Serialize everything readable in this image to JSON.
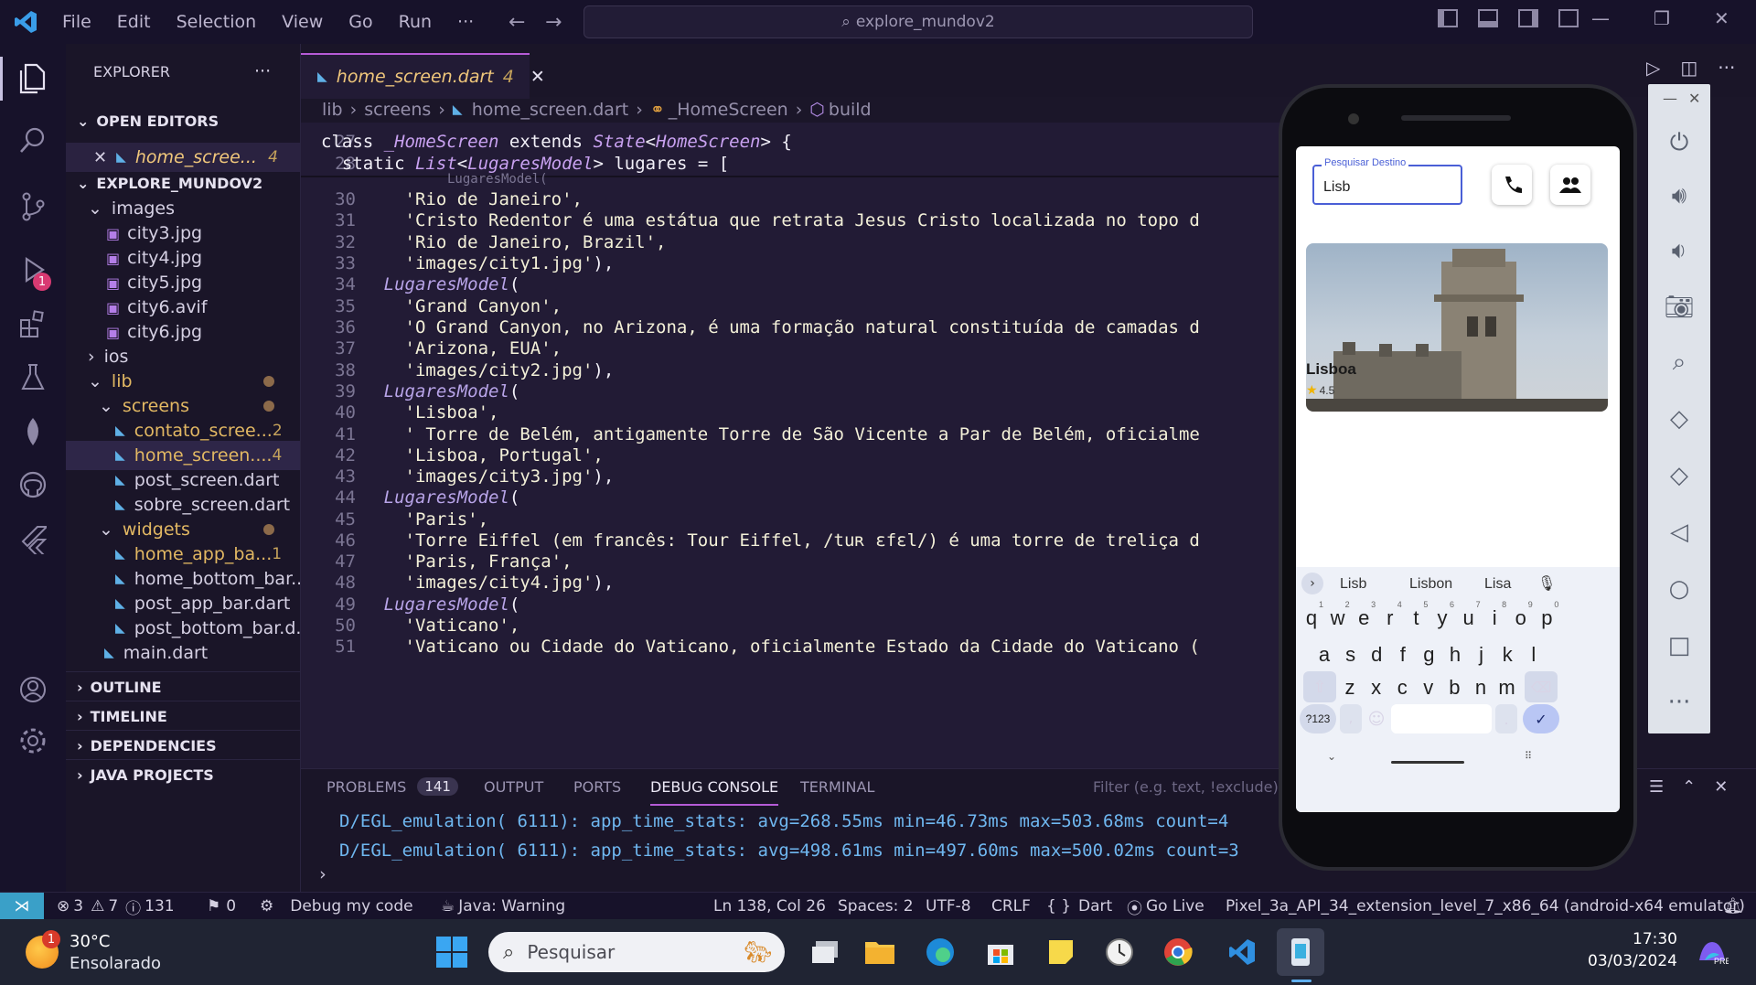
{
  "menu": [
    "File",
    "Edit",
    "Selection",
    "View",
    "Go",
    "Run",
    "···"
  ],
  "search": "explore_mundov2",
  "explorer": {
    "title": "EXPLORER",
    "open_editors": "OPEN EDITORS",
    "open_file": "home_scree...",
    "open_badge": "4",
    "project": "EXPLORE_MUNDOV2",
    "tree": [
      {
        "label": "images",
        "indent": 1,
        "type": "folder-open"
      },
      {
        "label": "city3.jpg",
        "indent": 2,
        "type": "img"
      },
      {
        "label": "city4.jpg",
        "indent": 2,
        "type": "img"
      },
      {
        "label": "city5.jpg",
        "indent": 2,
        "type": "img"
      },
      {
        "label": "city6.avif",
        "indent": 2,
        "type": "img"
      },
      {
        "label": "city6.jpg",
        "indent": 2,
        "type": "img"
      },
      {
        "label": "ios",
        "indent": 1,
        "type": "folder"
      },
      {
        "label": "lib",
        "indent": 1,
        "type": "folder-open-dot"
      },
      {
        "label": "screens",
        "indent": 2,
        "type": "folder-open-dot"
      },
      {
        "label": "contato_scree...",
        "indent": 3,
        "type": "dart-warn",
        "badge": "2"
      },
      {
        "label": "home_screen....",
        "indent": 3,
        "type": "dart-warn",
        "badge": "4",
        "active": true
      },
      {
        "label": "post_screen.dart",
        "indent": 3,
        "type": "dart"
      },
      {
        "label": "sobre_screen.dart",
        "indent": 3,
        "type": "dart"
      },
      {
        "label": "widgets",
        "indent": 2,
        "type": "folder-open-dot"
      },
      {
        "label": "home_app_ba...",
        "indent": 3,
        "type": "dart-warn",
        "badge": "1"
      },
      {
        "label": "home_bottom_bar....",
        "indent": 3,
        "type": "dart"
      },
      {
        "label": "post_app_bar.dart",
        "indent": 3,
        "type": "dart"
      },
      {
        "label": "post_bottom_bar.d...",
        "indent": 3,
        "type": "dart"
      },
      {
        "label": "main.dart",
        "indent": 2,
        "type": "dart"
      }
    ],
    "bottom_sections": [
      "OUTLINE",
      "TIMELINE",
      "DEPENDENCIES",
      "JAVA PROJECTS"
    ]
  },
  "tab": {
    "label": "home_screen.dart",
    "badge": "4"
  },
  "breadcrumb": [
    "lib",
    "screens",
    "home_screen.dart",
    "_HomeScreen",
    "build"
  ],
  "code": [
    {
      "n": "27",
      "parts": [
        [
          "kw",
          "class "
        ],
        [
          "cls",
          "_HomeScreen "
        ],
        [
          "kw",
          "extends "
        ],
        [
          "cls",
          "State"
        ],
        [
          "kw",
          "<"
        ],
        [
          "cls",
          "HomeScreen"
        ],
        [
          "kw",
          "> {"
        ]
      ]
    },
    {
      "n": "28",
      "parts": [
        [
          "kw",
          "  static "
        ],
        [
          "cls",
          "List"
        ],
        [
          "kw",
          "<"
        ],
        [
          "cls",
          "LugaresModel"
        ],
        [
          "kw",
          "> lugares = ["
        ]
      ]
    },
    {
      "n": "30",
      "parts": [
        [
          "str",
          "        'Rio de Janeiro',"
        ]
      ]
    },
    {
      "n": "31",
      "parts": [
        [
          "str",
          "        'Cristo Redentor é uma estátua que retrata Jesus Cristo localizada no topo d"
        ]
      ]
    },
    {
      "n": "32",
      "parts": [
        [
          "str",
          "        'Rio de Janeiro, Brazil',"
        ]
      ]
    },
    {
      "n": "33",
      "parts": [
        [
          "str",
          "        'images/city1.jpg'"
        ],
        [
          "kw",
          "),"
        ]
      ]
    },
    {
      "n": "34",
      "parts": [
        [
          "lm",
          "      LugaresModel"
        ],
        [
          "kw",
          "("
        ]
      ]
    },
    {
      "n": "35",
      "parts": [
        [
          "str",
          "        'Grand Canyon',"
        ]
      ]
    },
    {
      "n": "36",
      "parts": [
        [
          "str",
          "        'O Grand Canyon, no Arizona, é uma formação natural constituída de camadas d"
        ]
      ]
    },
    {
      "n": "37",
      "parts": [
        [
          "str",
          "        'Arizona, EUA',"
        ]
      ]
    },
    {
      "n": "38",
      "parts": [
        [
          "str",
          "        'images/city2.jpg'"
        ],
        [
          "kw",
          "),"
        ]
      ]
    },
    {
      "n": "39",
      "parts": [
        [
          "lm",
          "      LugaresModel"
        ],
        [
          "kw",
          "("
        ]
      ]
    },
    {
      "n": "40",
      "parts": [
        [
          "str",
          "        'Lisboa',"
        ]
      ]
    },
    {
      "n": "41",
      "parts": [
        [
          "str",
          "        ' Torre de Belém, antigamente Torre de São Vicente a Par de Belém, oficialme"
        ]
      ]
    },
    {
      "n": "42",
      "parts": [
        [
          "str",
          "        'Lisboa, Portugal',"
        ]
      ]
    },
    {
      "n": "43",
      "parts": [
        [
          "str",
          "        'images/city3.jpg'"
        ],
        [
          "kw",
          "),"
        ]
      ]
    },
    {
      "n": "44",
      "parts": [
        [
          "lm",
          "      LugaresModel"
        ],
        [
          "kw",
          "("
        ]
      ]
    },
    {
      "n": "45",
      "parts": [
        [
          "str",
          "        'Paris',"
        ]
      ]
    },
    {
      "n": "46",
      "parts": [
        [
          "str",
          "        'Torre Eiffel (em francês: Tour Eiffel, /tuʀ ɛfɛl/) é uma torre de treliça d"
        ]
      ]
    },
    {
      "n": "47",
      "parts": [
        [
          "str",
          "        'Paris, França',"
        ]
      ]
    },
    {
      "n": "48",
      "parts": [
        [
          "str",
          "        'images/city4.jpg'"
        ],
        [
          "kw",
          "),"
        ]
      ]
    },
    {
      "n": "49",
      "parts": [
        [
          "lm",
          "      LugaresModel"
        ],
        [
          "kw",
          "("
        ]
      ]
    },
    {
      "n": "50",
      "parts": [
        [
          "str",
          "        'Vaticano',"
        ]
      ]
    },
    {
      "n": "51",
      "parts": [
        [
          "str",
          "        'Vaticano ou Cidade do Vaticano, oficialmente Estado da Cidade do Vaticano ("
        ]
      ]
    }
  ],
  "panel": {
    "tabs": [
      "PROBLEMS",
      "OUTPUT",
      "PORTS",
      "DEBUG CONSOLE",
      "TERMINAL"
    ],
    "problems_count": "141",
    "filter_placeholder": "Filter (e.g. text, !exclude)",
    "lines": [
      "D/EGL_emulation( 6111): app_time_stats: avg=268.55ms min=46.73ms max=503.68ms count=4",
      "D/EGL_emulation( 6111): app_time_stats: avg=498.61ms min=497.60ms max=500.02ms count=3"
    ]
  },
  "status": {
    "errors": "3",
    "warnings": "7",
    "infos": "131",
    "ports": "0",
    "debug": "Debug my code",
    "java": "Java: Warning",
    "position": "Ln 138, Col 26",
    "spaces": "Spaces: 2",
    "encoding": "UTF-8",
    "eol": "CRLF",
    "lang": "Dart",
    "golive": "Go Live",
    "device": "Pixel_3a_API_34_extension_level_7_x86_64 (android-x64 emulator)"
  },
  "taskbar": {
    "temp": "30°C",
    "weather": "Ensolarado",
    "weather_badge": "1",
    "search": "Pesquisar",
    "time": "17:30",
    "date": "03/03/2024"
  },
  "phone": {
    "field_label": "Pesquisar Destino",
    "field_value": "Lisb",
    "card_title": "Lisboa",
    "rating": "4.5",
    "suggestions": [
      "Lisb",
      "Lisbon",
      "Lisa"
    ],
    "row1": [
      "q",
      "w",
      "e",
      "r",
      "t",
      "y",
      "u",
      "i",
      "o",
      "p"
    ],
    "row1_num": [
      "1",
      "2",
      "3",
      "4",
      "5",
      "6",
      "7",
      "8",
      "9",
      "0"
    ],
    "row2": [
      "a",
      "s",
      "d",
      "f",
      "g",
      "h",
      "j",
      "k",
      "l"
    ],
    "row3": [
      "z",
      "x",
      "c",
      "v",
      "b",
      "n",
      "m"
    ],
    "sym": "?123",
    "comma": ",",
    "period": "."
  }
}
